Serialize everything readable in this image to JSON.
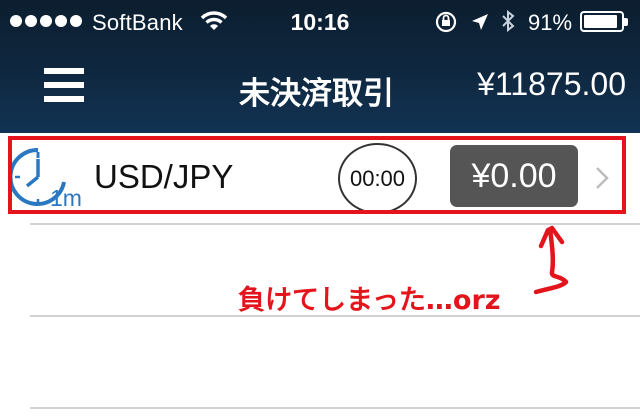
{
  "status_bar": {
    "carrier": "SoftBank",
    "time": "10:16",
    "battery_percent": "91%",
    "battery_level": 0.91
  },
  "nav": {
    "title": "未決済取引",
    "balance": "¥11875.00"
  },
  "trades": [
    {
      "interval": "1m",
      "pair": "USD/JPY",
      "timer": "00:00",
      "pnl": "¥0.00"
    }
  ],
  "annotation": {
    "text": "負けてしまった…orz"
  },
  "colors": {
    "header_bg": "#0f2840",
    "accent_blue": "#2b78c2",
    "highlight_red": "#e4131c",
    "pnl_badge": "#555555"
  },
  "icons": [
    "signal-dots-icon",
    "wifi-icon",
    "rotation-lock-icon",
    "location-arrow-icon",
    "bluetooth-icon",
    "battery-icon",
    "menu-icon",
    "clock-icon",
    "chevron-right-icon"
  ]
}
